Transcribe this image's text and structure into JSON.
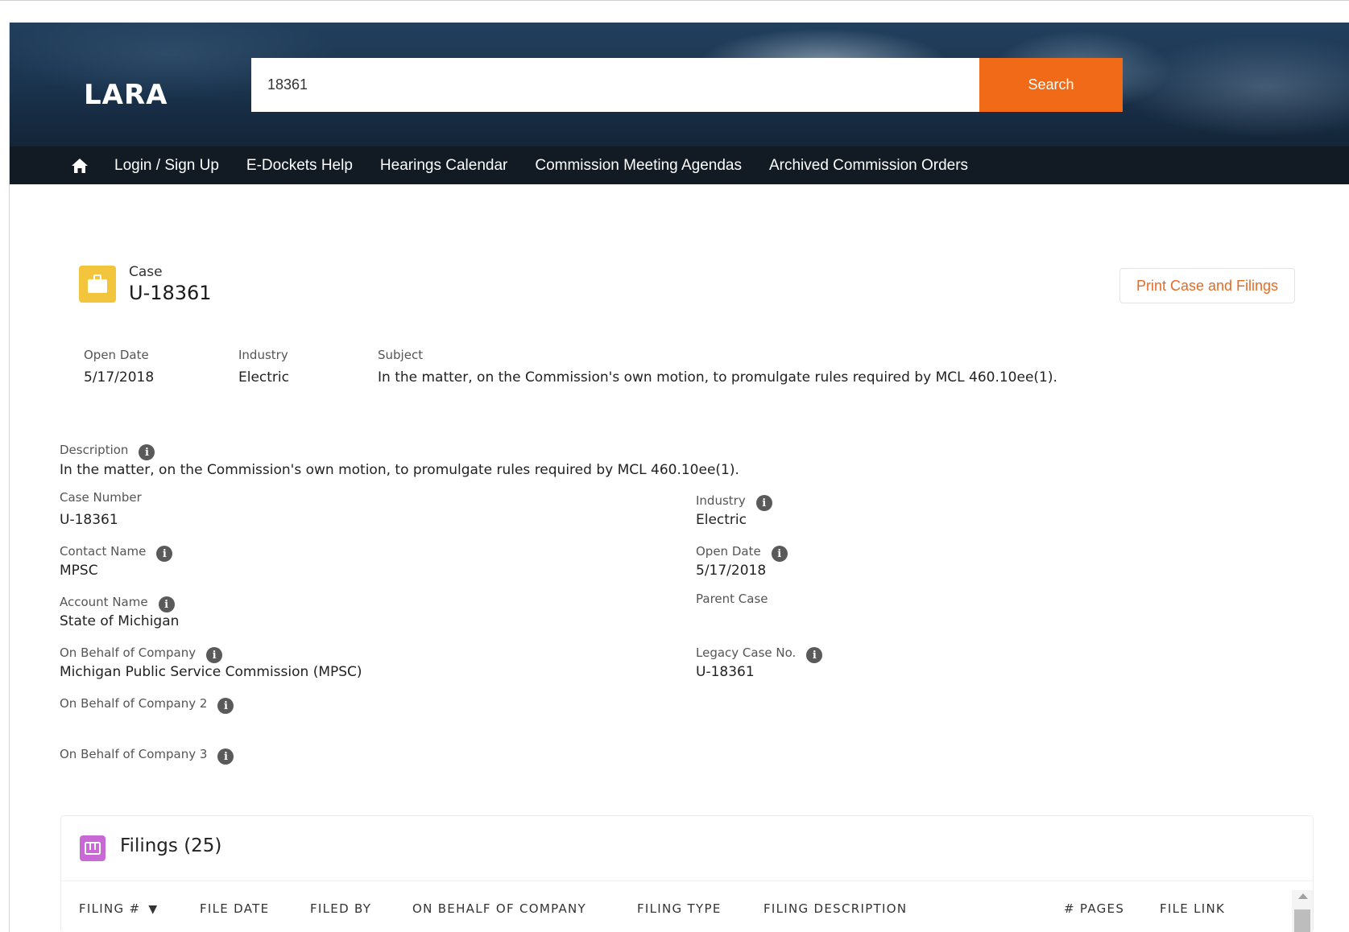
{
  "header": {
    "logo_text": "LARA",
    "search": {
      "value": "18361",
      "button_label": "Search"
    }
  },
  "nav": {
    "home_icon": "home-icon",
    "items": [
      {
        "label": "Login / Sign Up"
      },
      {
        "label": "E-Dockets Help"
      },
      {
        "label": "Hearings Calendar"
      },
      {
        "label": "Commission Meeting Agendas"
      },
      {
        "label": "Archived Commission Orders"
      }
    ]
  },
  "case": {
    "icon": "briefcase-icon",
    "label": "Case",
    "number": "U-18361",
    "print_button": "Print Case and Filings",
    "summary": {
      "open_date_label": "Open Date",
      "open_date": "5/17/2018",
      "industry_label": "Industry",
      "industry": "Electric",
      "subject_label": "Subject",
      "subject": "In the matter, on the Commission's own motion, to promulgate rules required by MCL 460.10ee(1)."
    }
  },
  "details": {
    "description_label": "Description",
    "description": "In the matter, on the Commission's own motion, to promulgate rules required by MCL 460.10ee(1).",
    "case_number_label": "Case Number",
    "case_number": "U-18361",
    "industry_label": "Industry",
    "industry": "Electric",
    "contact_name_label": "Contact Name",
    "contact_name": "MPSC",
    "open_date_label": "Open Date",
    "open_date": "5/17/2018",
    "account_name_label": "Account Name",
    "account_name": "State of Michigan",
    "parent_case_label": "Parent Case",
    "on_behalf_label": "On Behalf of Company",
    "on_behalf": "Michigan Public Service Commission (MPSC)",
    "legacy_case_label": "Legacy Case No.",
    "legacy_case": "U-18361",
    "on_behalf2_label": "On Behalf of Company 2",
    "on_behalf3_label": "On Behalf of Company 3",
    "info_icon": "info-icon"
  },
  "filings": {
    "title": "Filings (25)",
    "icon": "filings-icon",
    "columns": [
      {
        "label": "FILING #"
      },
      {
        "label": "FILE DATE"
      },
      {
        "label": "FILED BY"
      },
      {
        "label": "ON BEHALF OF COMPANY"
      },
      {
        "label": "FILING TYPE"
      },
      {
        "label": "FILING DESCRIPTION"
      },
      {
        "label": "# PAGES"
      },
      {
        "label": "FILE LINK"
      }
    ],
    "sort_indicator": "▼"
  },
  "colors": {
    "accent": "#f06a17",
    "nav_bg": "#121a24",
    "case_icon": "#f2c53d",
    "filings_icon": "#c869d6",
    "print_text": "#e86a22"
  }
}
